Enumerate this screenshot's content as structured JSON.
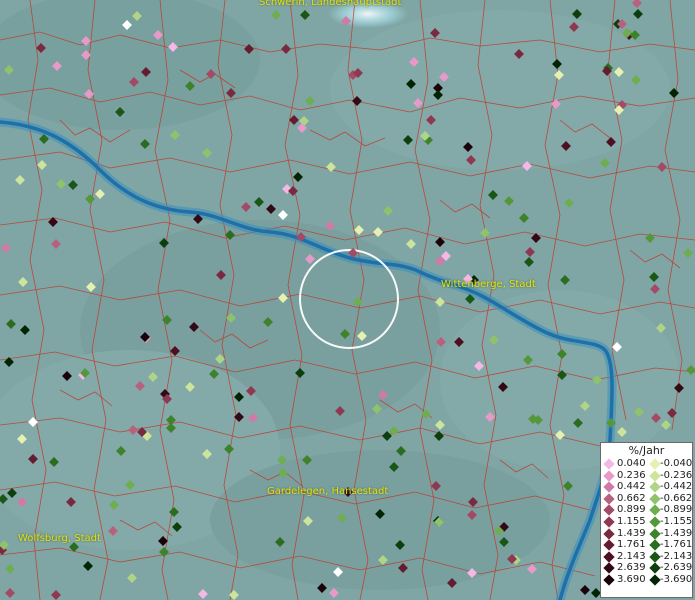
{
  "places": {
    "schwerin": "Schwerin, Landeshauptstadt",
    "wittenberge": "Wittenberge, Stadt",
    "gardelegen": "Gardelegen, Hansestadt",
    "wolfsburg": "Wolfsburg, Stadt"
  },
  "legend": {
    "title": "%/Jahr",
    "positive": [
      {
        "label": "0.040",
        "color": "#f4b8e6"
      },
      {
        "label": "0.236",
        "color": "#e79ac9"
      },
      {
        "label": "0.442",
        "color": "#d07aa6"
      },
      {
        "label": "0.662",
        "color": "#b9607f"
      },
      {
        "label": "0.899",
        "color": "#a44a66"
      },
      {
        "label": "1.155",
        "color": "#8e3951"
      },
      {
        "label": "1.439",
        "color": "#7a2a40"
      },
      {
        "label": "1.761",
        "color": "#631c30"
      },
      {
        "label": "2.143",
        "color": "#4c1022"
      },
      {
        "label": "2.639",
        "color": "#340916"
      },
      {
        "label": "3.690",
        "color": "#1b030a"
      }
    ],
    "negative": [
      {
        "label": "-0.040",
        "color": "#e6f0b0"
      },
      {
        "label": "-0.236",
        "color": "#cde49c"
      },
      {
        "label": "-0.442",
        "color": "#b0d486"
      },
      {
        "label": "-0.662",
        "color": "#8fc26a"
      },
      {
        "label": "-0.899",
        "color": "#6fae50"
      },
      {
        "label": "-1.155",
        "color": "#55983c"
      },
      {
        "label": "-1.439",
        "color": "#3e832c"
      },
      {
        "label": "-1.761",
        "color": "#2a6d20"
      },
      {
        "label": "-2.143",
        "color": "#1a5616"
      },
      {
        "label": "-2.639",
        "color": "#0d3e0d"
      },
      {
        "label": "-3.690",
        "color": "#032403"
      }
    ]
  },
  "colors": {
    "background": "#7fa6a4",
    "river": "#2e7fb5",
    "borders": "#c0392b",
    "place_label": "#e8e000"
  }
}
